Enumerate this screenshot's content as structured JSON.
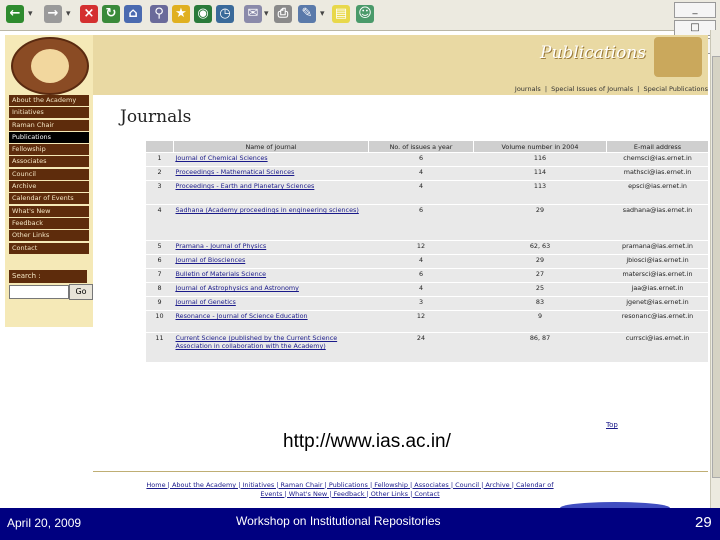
{
  "browser": {
    "toolbar_icons": [
      "back-icon",
      "forward-icon",
      "stop-icon",
      "refresh-icon",
      "home-icon",
      "search-icon",
      "favorites-icon",
      "media-icon",
      "history-icon",
      "mail-icon",
      "print-icon",
      "edit-icon",
      "discuss-icon",
      "messenger-icon"
    ],
    "window_controls": [
      "_",
      "□",
      "X"
    ]
  },
  "site": {
    "header_title": "Publications",
    "top_links": [
      "Journals",
      "|",
      "Special Issues of Journals",
      "|",
      "Special Publications"
    ],
    "page_heading": "Journals",
    "sidebar_items": [
      {
        "label": "About the Academy",
        "active": false
      },
      {
        "label": "Initiatives",
        "active": false
      },
      {
        "label": "Raman Chair",
        "active": false
      },
      {
        "label": "Publications",
        "active": true
      },
      {
        "label": "Fellowship",
        "active": false
      },
      {
        "label": "Associates",
        "active": false
      },
      {
        "label": "Council",
        "active": false
      },
      {
        "label": "Archive",
        "active": false
      },
      {
        "label": "Calendar of Events",
        "active": false
      },
      {
        "label": "What's New",
        "active": false
      },
      {
        "label": "Feedback",
        "active": false
      },
      {
        "label": "Other Links",
        "active": false
      },
      {
        "label": "Contact",
        "active": false
      }
    ],
    "search_label": "Search :",
    "search_button": "Go",
    "table": {
      "headers": [
        "",
        "Name of journal",
        "No. of issues a year",
        "Volume number in 2004",
        "E-mail address"
      ],
      "rows": [
        {
          "idx": "1",
          "name": "Journal of Chemical Sciences",
          "issues": "6",
          "volume": "116",
          "email": "chemsci@ias.ernet.in"
        },
        {
          "idx": "2",
          "name": "Proceedings - Mathematical Sciences",
          "issues": "4",
          "volume": "114",
          "email": "mathsci@ias.ernet.in"
        },
        {
          "idx": "3",
          "name": "Proceedings - Earth and Planetary Sciences",
          "issues": "4",
          "volume": "113",
          "email": "epsci@ias.ernet.in"
        },
        {
          "idx": "4",
          "name": "Sadhana (Academy proceedings in engineering sciences)",
          "issues": "6",
          "volume": "29",
          "email": "sadhana@ias.ernet.in"
        },
        {
          "idx": "5",
          "name": "Pramana - Journal of Physics",
          "issues": "12",
          "volume": "62, 63",
          "email": "pramana@ias.ernet.in"
        },
        {
          "idx": "6",
          "name": "Journal of Biosciences",
          "issues": "4",
          "volume": "29",
          "email": "jbiosci@ias.ernet.in"
        },
        {
          "idx": "7",
          "name": "Bulletin of Materials Science",
          "issues": "6",
          "volume": "27",
          "email": "matersci@ias.ernet.in"
        },
        {
          "idx": "8",
          "name": "Journal of Astrophysics and Astronomy",
          "issues": "4",
          "volume": "25",
          "email": "jaa@ias.ernet.in"
        },
        {
          "idx": "9",
          "name": "Journal of Genetics",
          "issues": "3",
          "volume": "83",
          "email": "jgenet@ias.ernet.in"
        },
        {
          "idx": "10",
          "name": "Resonance - Journal of Science Education",
          "issues": "12",
          "volume": "9",
          "email": "resonanc@ias.ernet.in"
        },
        {
          "idx": "11",
          "name": "Current Science (published by the Current Science Association in collaboration with the Academy)",
          "issues": "24",
          "volume": "86, 87",
          "email": "currsci@ias.ernet.in"
        }
      ]
    },
    "top_link": "Top",
    "footer_links": "Home | About the Academy | Initiatives | Raman Chair | Publications | Fellowship | Associates | Council | Archive | Calendar of Events | What's New | Feedback | Other Links | Contact"
  },
  "overlay_url": "http://www.ias.ac.in/",
  "slide": {
    "date": "April 20, 2009",
    "title": "Workshop on Institutional Repositories",
    "page": "29"
  },
  "colors": {
    "sidebar_bg": "#f5e9b7",
    "nav_bg": "#5e2c0c",
    "header_bg": "#e9d9a3",
    "slide_bar": "#000080"
  }
}
